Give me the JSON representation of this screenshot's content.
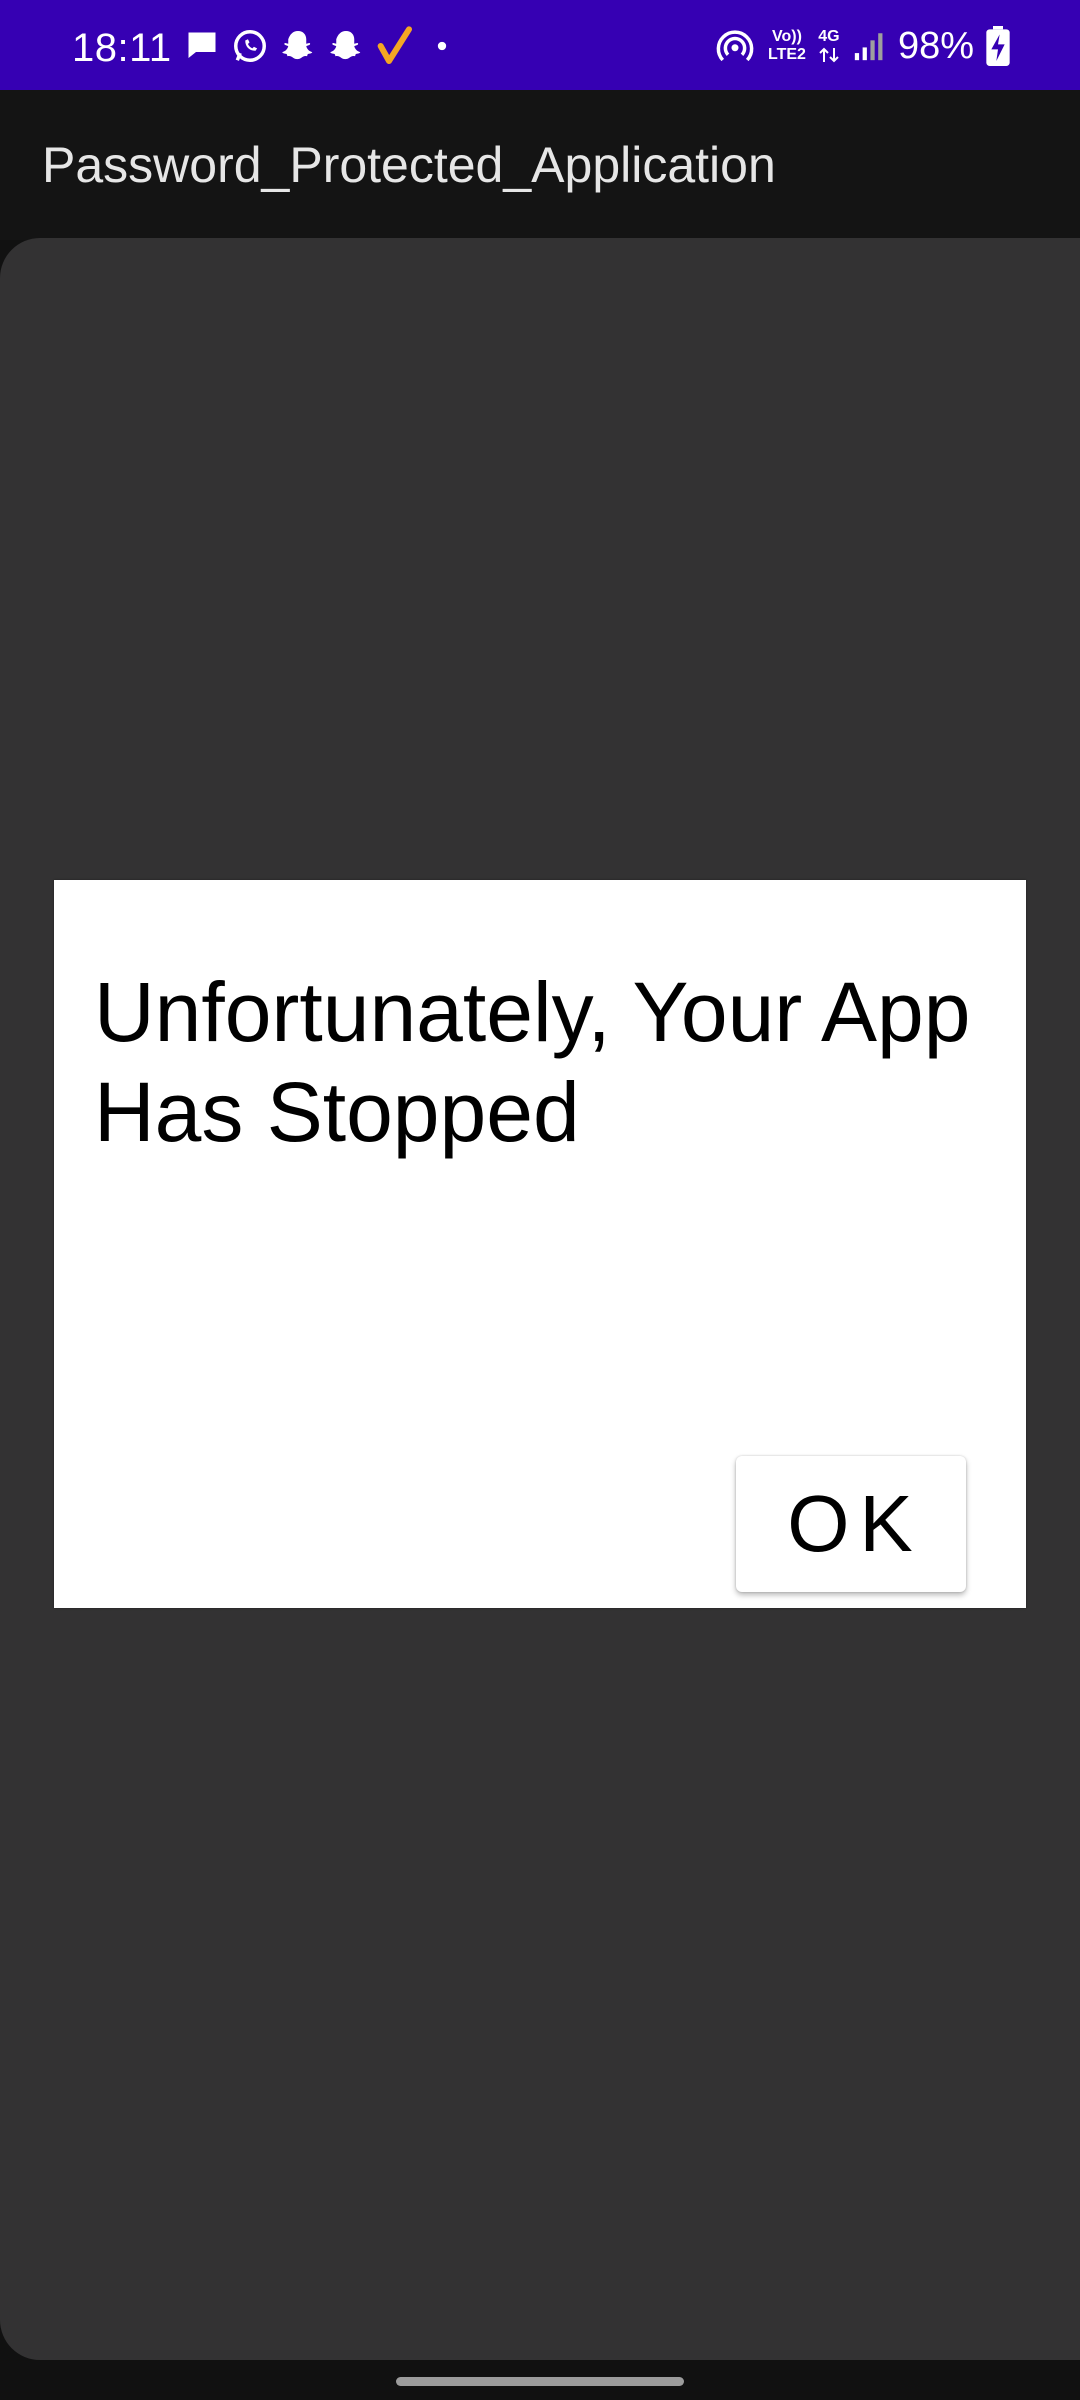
{
  "status_bar": {
    "time": "18:11",
    "background_color": "#3600B3",
    "notification_icons": [
      {
        "name": "message-icon"
      },
      {
        "name": "whatsapp-icon"
      },
      {
        "name": "snapchat-icon"
      },
      {
        "name": "snapchat-icon"
      },
      {
        "name": "checkmark-icon",
        "color": "#F5A623"
      },
      {
        "name": "dot-icon"
      }
    ],
    "volte_top": "Vo))",
    "volte_bottom": "LTE2",
    "network_type": "4G",
    "battery": "98%"
  },
  "app_bar": {
    "title": "Password_Protected_Application"
  },
  "dialog": {
    "message": "Unfortunately, Your App Has Stopped",
    "ok_label": "OK"
  }
}
